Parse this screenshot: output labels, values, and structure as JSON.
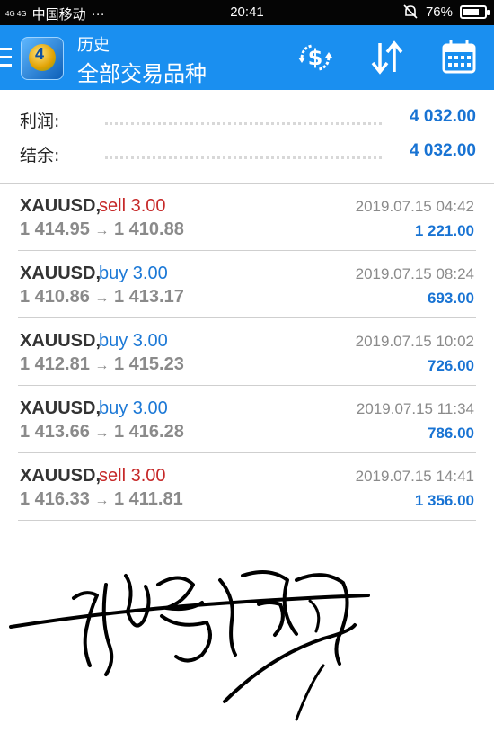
{
  "status_bar": {
    "network": "4G 4G",
    "carrier": "中国移动",
    "more": "···",
    "time": "20:41",
    "battery": "76%",
    "battery_level": 0.76
  },
  "header": {
    "subtitle": "历史",
    "title": "全部交易品种"
  },
  "summary": [
    {
      "label": "利润:",
      "value": "4 032.00"
    },
    {
      "label": "结余:",
      "value": "4 032.00"
    }
  ],
  "trades": [
    {
      "symbol": "XAUUSD,",
      "side": "sell 3.00",
      "type": "sell",
      "open": "1 414.95",
      "arrow": "→",
      "close": "1 410.88",
      "time": "2019.07.15 04:42",
      "profit": "1 221.00"
    },
    {
      "symbol": "XAUUSD,",
      "side": "buy 3.00",
      "type": "buy",
      "open": "1 410.86",
      "arrow": "→",
      "close": "1 413.17",
      "time": "2019.07.15 08:24",
      "profit": "693.00"
    },
    {
      "symbol": "XAUUSD,",
      "side": "buy 3.00",
      "type": "buy",
      "open": "1 412.81",
      "arrow": "→",
      "close": "1 415.23",
      "time": "2019.07.15 10:02",
      "profit": "726.00"
    },
    {
      "symbol": "XAUUSD,",
      "side": "buy 3.00",
      "type": "buy",
      "open": "1 413.66",
      "arrow": "→",
      "close": "1 416.28",
      "time": "2019.07.15 11:34",
      "profit": "786.00"
    },
    {
      "symbol": "XAUUSD,",
      "side": "sell 3.00",
      "type": "sell",
      "open": "1 416.33",
      "arrow": "→",
      "close": "1 411.81",
      "time": "2019.07.15 14:41",
      "profit": "1 356.00"
    }
  ],
  "colors": {
    "appbar": "#1a8ff0",
    "profit": "#1873d3",
    "sell": "#c62828",
    "buy": "#1b78d6"
  },
  "icons": {
    "menu": "hamburger-icon",
    "app_logo": "metatrader4-logo",
    "deposit": "currency-exchange-icon",
    "sort": "sort-arrows-icon",
    "period": "calendar-icon",
    "signature": "handwritten-signature"
  }
}
